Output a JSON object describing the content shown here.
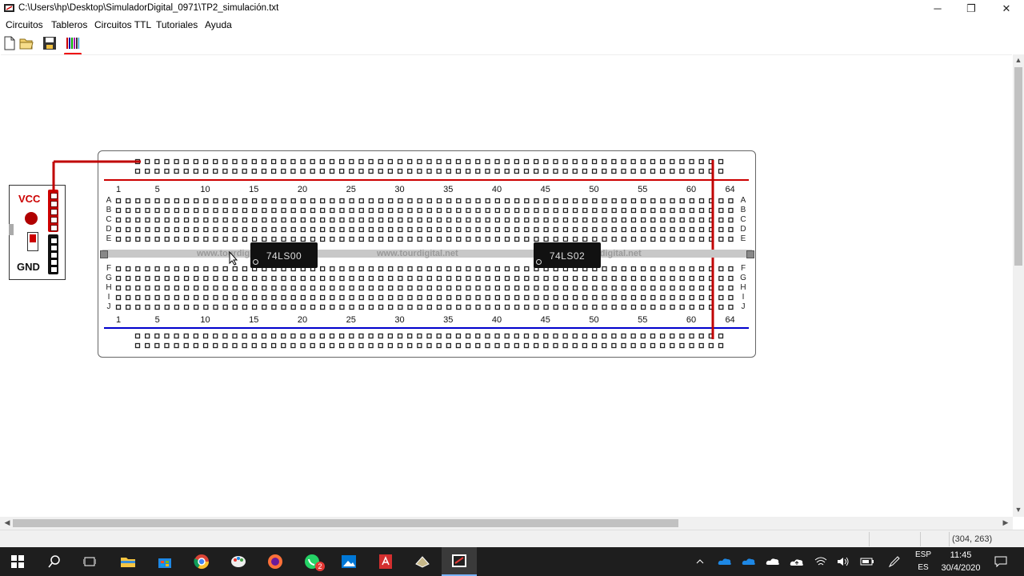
{
  "window": {
    "title": "C:\\Users\\hp\\Desktop\\SimuladorDigital_0971\\TP2_simulación.txt",
    "buttons": {
      "minimize": "─",
      "restore": "❐",
      "close": "✕"
    }
  },
  "menu": [
    "Circuitos",
    "Tableros",
    "Circuitos TTL",
    "Tutoriales",
    "Ayuda"
  ],
  "toolbar": {
    "icons": [
      "new-file-icon",
      "open-folder-icon",
      "save-icon",
      "color-palette-icon"
    ]
  },
  "power_module": {
    "vcc_label": "VCC",
    "gnd_label": "GND"
  },
  "breadboard": {
    "column_numbers": [
      "1",
      "5",
      "10",
      "15",
      "20",
      "25",
      "30",
      "35",
      "40",
      "45",
      "50",
      "55",
      "60",
      "64"
    ],
    "upper_rows": [
      "A",
      "B",
      "C",
      "D",
      "E"
    ],
    "lower_rows": [
      "F",
      "G",
      "H",
      "I",
      "J"
    ],
    "watermark": "www.tourdigital.net",
    "chips": [
      "74LS00",
      "74LS02"
    ],
    "rail_colors": {
      "positive": "#cc0000",
      "negative": "#0000cc",
      "wire": "#c00000"
    }
  },
  "statusbar": {
    "coords": "(304, 263)"
  },
  "taskbar": {
    "lang_top": "ESP",
    "lang_bottom": "ES",
    "time": "11:45",
    "date": "30/4/2020",
    "whatsapp_badge": "2"
  }
}
